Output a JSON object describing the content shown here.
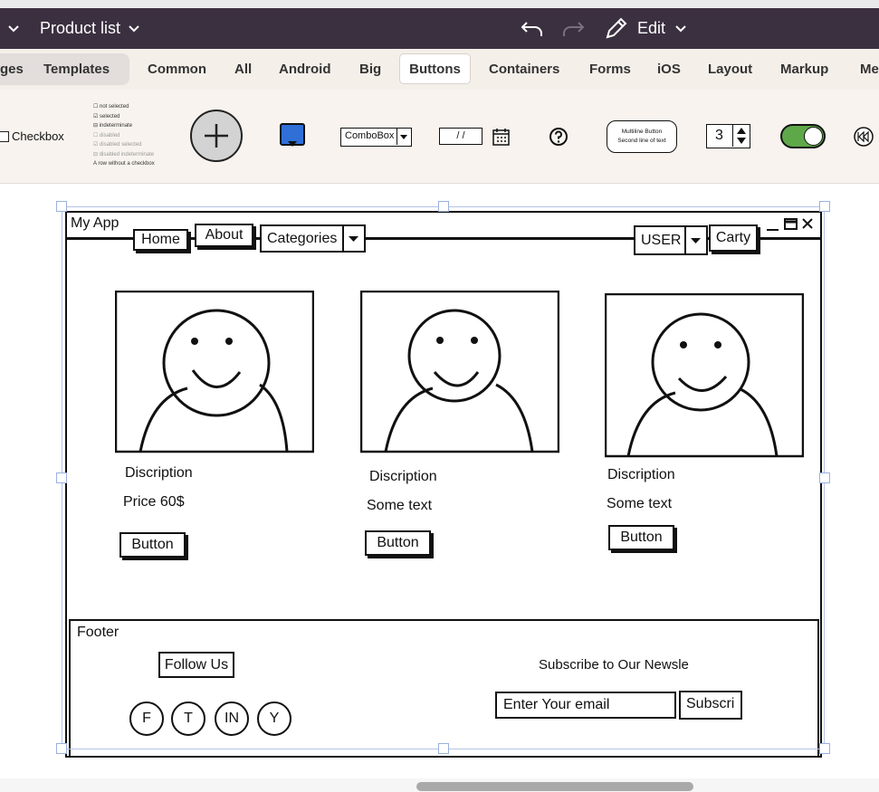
{
  "titlebar": {
    "page_title": "Product list",
    "edit_label": "Edit",
    "bg": "#3b3040"
  },
  "categories": {
    "tabs": [
      "ges",
      "Templates",
      "Common",
      "All",
      "Android",
      "Big",
      "Buttons",
      "Containers",
      "Forms",
      "iOS",
      "Layout",
      "Markup",
      "Me"
    ],
    "selected": "Buttons"
  },
  "palette": {
    "checkbox_label": "Checkbox",
    "checkbox_list": [
      "not selected",
      "selected",
      "indeterminate",
      "disabled",
      "disabled selected",
      "disabled indeterminate",
      "A row without a checkbox"
    ],
    "combobox_label": "ComboBox",
    "date_placeholder": "/ /",
    "multiline_line1": "Multiline Button",
    "multiline_line2": "Second line of text",
    "stepper_value": "3",
    "toggle_color": "#5fa84a",
    "blue_color": "#2f6fd6"
  },
  "mockup": {
    "window_title": "My App",
    "nav": {
      "home": "Home",
      "about": "About",
      "categories": "Categories",
      "user": "USER",
      "cart": "Carty"
    },
    "products": [
      {
        "title": "Discription",
        "subtitle": "Price 60$",
        "button": "Button"
      },
      {
        "title": "Discription",
        "subtitle": "Some text",
        "button": "Button"
      },
      {
        "title": "Discription",
        "subtitle": "Some text",
        "button": "Button"
      }
    ],
    "footer": {
      "label": "Footer",
      "follow_us": "Follow Us",
      "socials": [
        "F",
        "T",
        "IN",
        "Y"
      ],
      "subscribe_heading": "Subscribe to Our Newsle",
      "email_placeholder": "Enter Your email",
      "subscribe_button": "Subscri"
    }
  }
}
